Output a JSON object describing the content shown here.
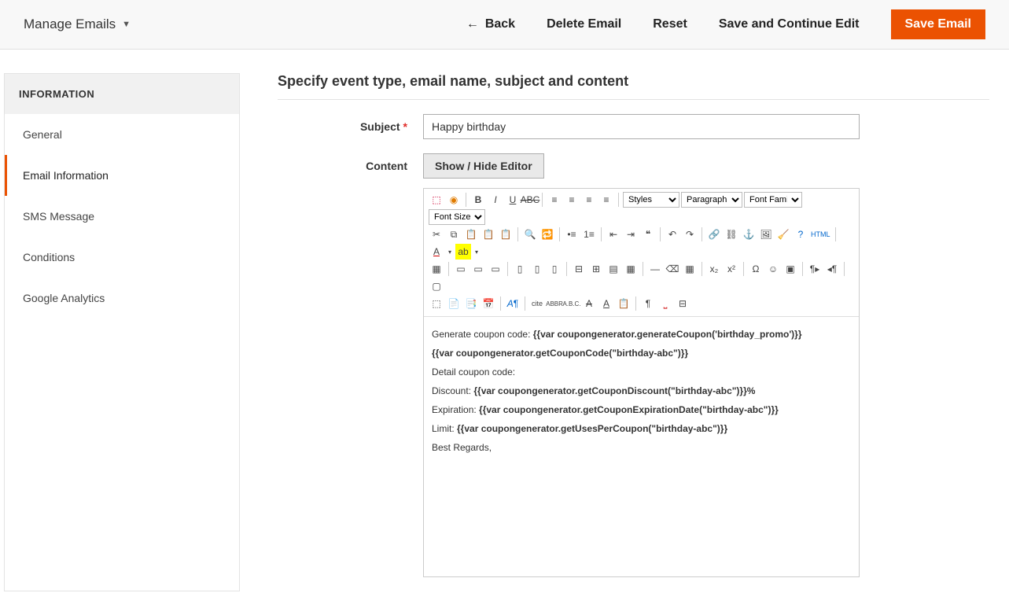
{
  "topbar": {
    "title": "Manage Emails",
    "back": "Back",
    "delete": "Delete Email",
    "reset": "Reset",
    "save_continue": "Save and Continue Edit",
    "save": "Save Email"
  },
  "sidebar": {
    "header": "INFORMATION",
    "items": [
      {
        "label": "General"
      },
      {
        "label": "Email Information"
      },
      {
        "label": "SMS Message"
      },
      {
        "label": "Conditions"
      },
      {
        "label": "Google Analytics"
      }
    ]
  },
  "main": {
    "heading": "Specify event type, email name, subject and content",
    "subject_label": "Subject",
    "subject_value": "Happy birthday",
    "content_label": "Content",
    "toggle_label": "Show / Hide Editor"
  },
  "editor_selects": {
    "styles": "Styles",
    "paragraph": "Paragraph",
    "font_family": "Font Family",
    "font_size": "Font Size"
  },
  "email_body": {
    "line1_pre": "Generate coupon code: ",
    "line1_code": "{{var coupongenerator.generateCoupon('birthday_promo')}}",
    "line2": "{{var coupongenerator.getCouponCode(\"birthday-abc\")}}",
    "line3": "Detail coupon code:",
    "line4_pre": "Discount: ",
    "line4_code": "{{var coupongenerator.getCouponDiscount(\"birthday-abc\")}}%",
    "line5_pre": "Expiration: ",
    "line5_code": "{{var coupongenerator.getCouponExpirationDate(\"birthday-abc\")}}",
    "line6_pre": "Limit: ",
    "line6_code": "{{var coupongenerator.getUsesPerCoupon(\"birthday-abc\")}}",
    "line7": "Best Regards,"
  }
}
